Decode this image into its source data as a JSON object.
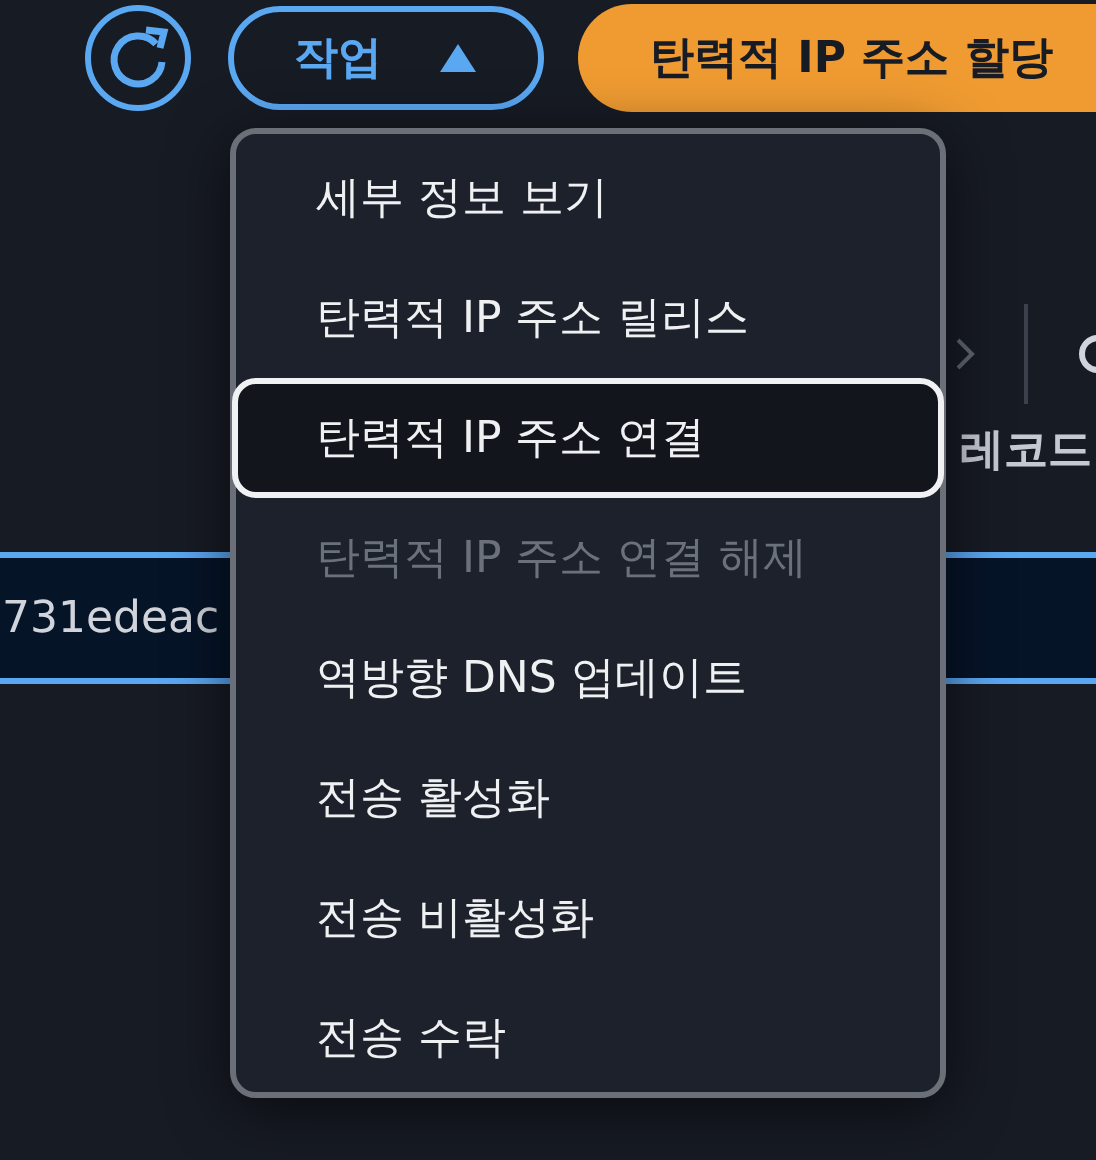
{
  "toolbar": {
    "actions_button": {
      "label": "작업",
      "expanded": true
    },
    "primary_button": {
      "label": "탄력적 IP 주소 할당"
    }
  },
  "table": {
    "column_header": "레코드",
    "selected_row": {
      "cell": "731edeac",
      "selected": true
    }
  },
  "menu": {
    "items": [
      {
        "label": "세부 정보 보기",
        "disabled": false,
        "focused": false
      },
      {
        "label": "탄력적 IP 주소 릴리스",
        "disabled": false,
        "focused": false
      },
      {
        "label": "탄력적 IP 주소 연결",
        "disabled": false,
        "focused": true
      },
      {
        "label": "탄력적 IP 주소 연결 해제",
        "disabled": true,
        "focused": false
      },
      {
        "label": "역방향 DNS 업데이트",
        "disabled": false,
        "focused": false
      },
      {
        "label": "전송 활성화",
        "disabled": false,
        "focused": false
      },
      {
        "label": "전송 비활성화",
        "disabled": false,
        "focused": false
      },
      {
        "label": "전송 수락",
        "disabled": false,
        "focused": false
      }
    ]
  }
}
